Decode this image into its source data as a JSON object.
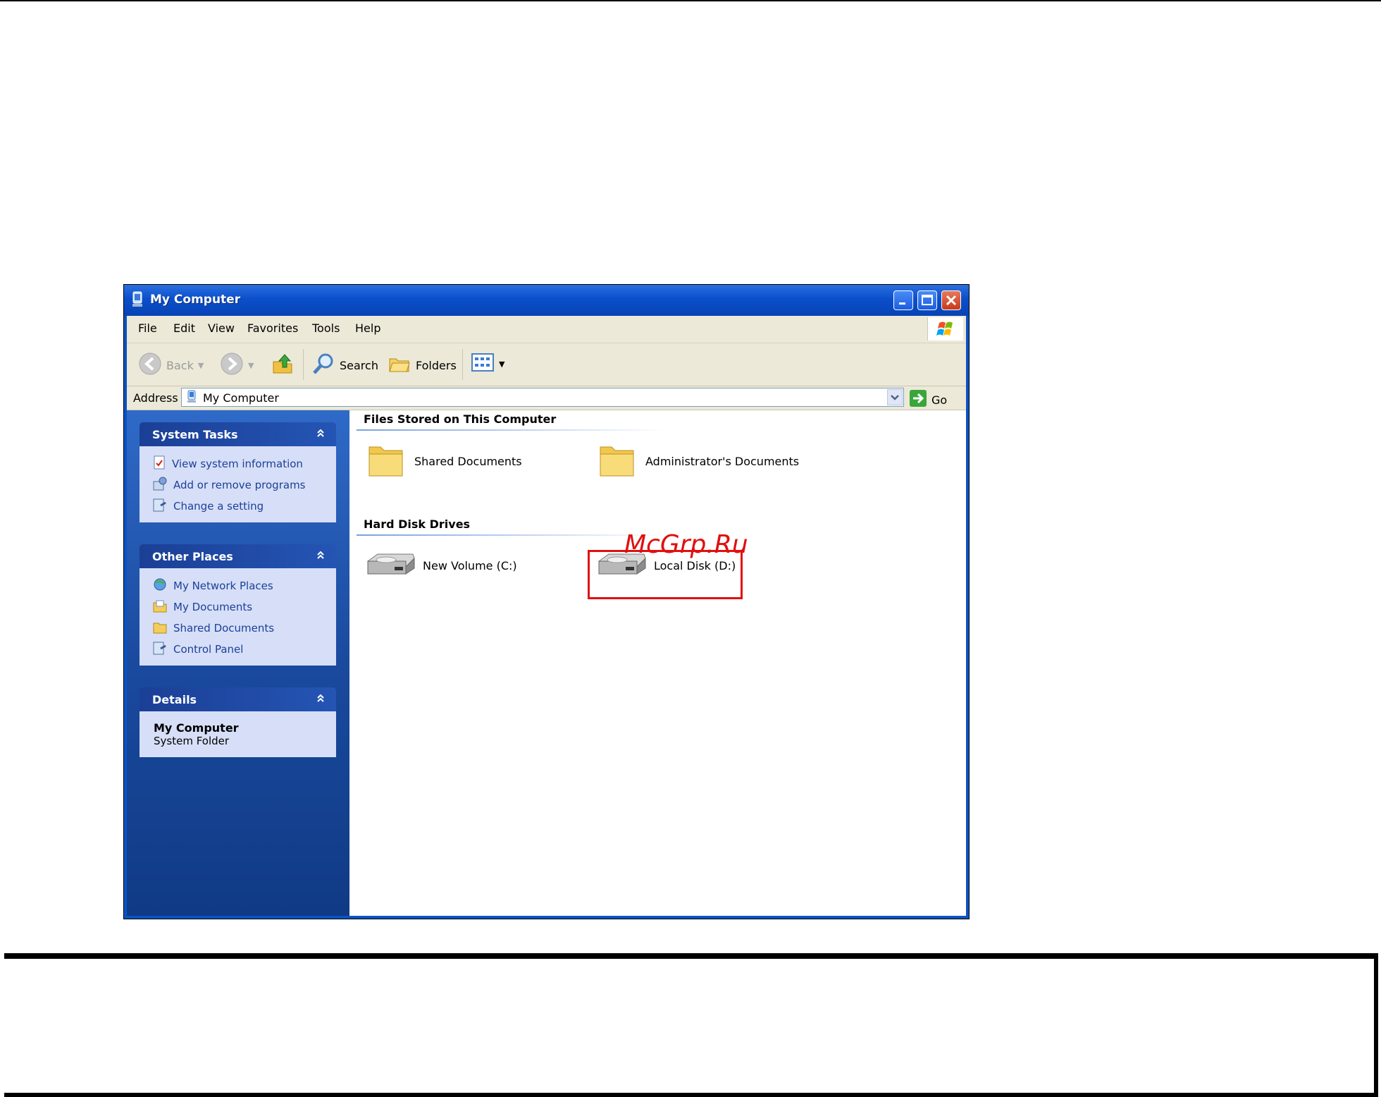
{
  "window": {
    "title": "My Computer"
  },
  "menu": [
    "File",
    "Edit",
    "View",
    "Favorites",
    "Tools",
    "Help"
  ],
  "toolbar": {
    "back_label": "Back",
    "search_label": "Search",
    "folders_label": "Folders"
  },
  "address": {
    "label": "Address",
    "value": "My Computer",
    "go_label": "Go"
  },
  "system_tasks": {
    "title": "System Tasks",
    "items": [
      "View system information",
      "Add or remove programs",
      "Change a setting"
    ]
  },
  "other_places": {
    "title": "Other Places",
    "items": [
      "My Network Places",
      "My Documents",
      "Shared Documents",
      "Control Panel"
    ]
  },
  "details": {
    "title": "Details",
    "name": "My Computer",
    "type": "System Folder"
  },
  "content": {
    "files_group": "Files Stored on This Computer",
    "files": [
      "Shared Documents",
      "Administrator's Documents"
    ],
    "drives_group": "Hard Disk Drives",
    "drives": [
      "New Volume (C:)",
      "Local Disk (D:)"
    ]
  },
  "watermark": "McGrp.Ru",
  "colors": {
    "highlight": "#e01010",
    "titlebar": "#0a4fcb",
    "taskpane": "#1a4a9e"
  }
}
